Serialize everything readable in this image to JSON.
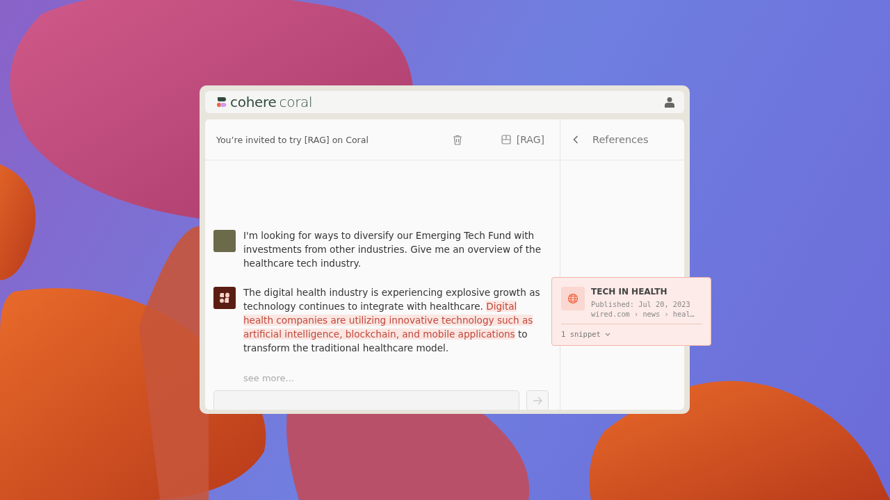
{
  "brand": {
    "name": "cohere",
    "product": "coral"
  },
  "chat": {
    "title": "You’re invited to try [RAG] on Coral",
    "mode_label": "[RAG]",
    "messages": [
      {
        "kind": "user",
        "segments": [
          {
            "text": "I'm looking for ways to diversify our Emerging Tech Fund with investments from other industries. Give me an overview of the healthcare tech industry.",
            "highlighted": false
          }
        ]
      },
      {
        "kind": "bot",
        "segments": [
          {
            "text": "The digital health industry is experiencing explosive growth as technology continues to integrate with healthcare. ",
            "highlighted": false
          },
          {
            "text": "Digital health companies are utilizing innovative technology such as artificial intelligence, blockchain, and mobile applications",
            "highlighted": true
          },
          {
            "text": " to transform the traditional healthcare model.",
            "highlighted": false
          }
        ]
      }
    ],
    "see_more": "see more..."
  },
  "references": {
    "title": "References",
    "cards": [
      {
        "title": "TECH IN HEALTH",
        "published": "Published: Jul 20, 2023",
        "source": "wired.com › news › heal…",
        "snippets": "1 snippet"
      }
    ]
  }
}
